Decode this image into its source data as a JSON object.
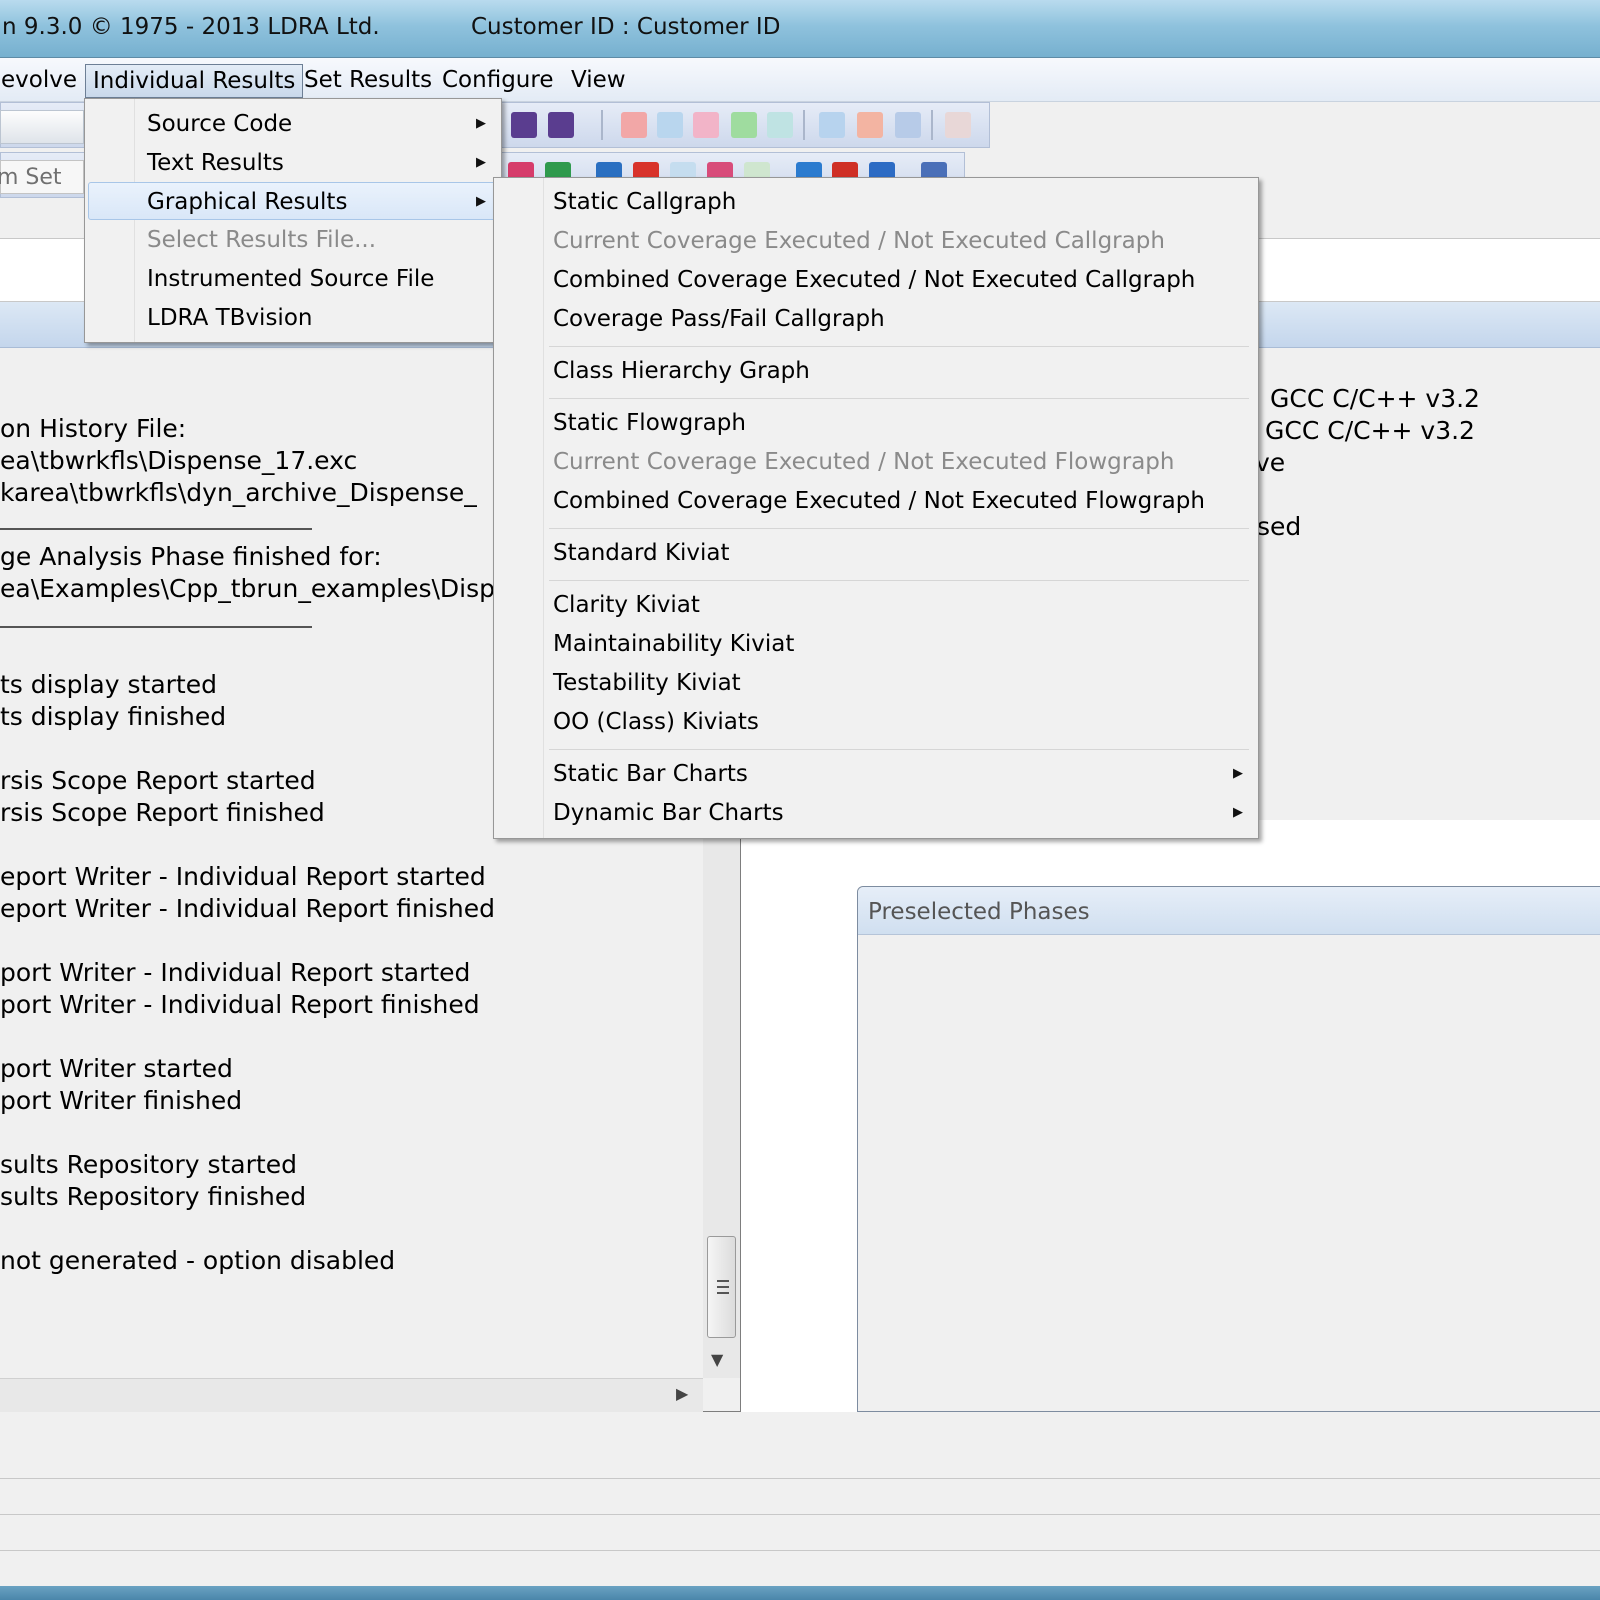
{
  "window": {
    "title": "n 9.3.0 © 1975 - 2013 LDRA Ltd.",
    "customer": "Customer ID : Customer ID"
  },
  "menubar": {
    "items": [
      "evolve",
      "Individual Results",
      "Set Results",
      "Configure",
      "View"
    ]
  },
  "toolbar": {
    "left_label": "m Set"
  },
  "individual_results_menu": {
    "items": [
      {
        "label": "Source Code",
        "submenu": true,
        "enabled": true
      },
      {
        "label": "Text Results",
        "submenu": true,
        "enabled": true
      },
      {
        "label": "Graphical Results",
        "submenu": true,
        "enabled": true,
        "highlighted": true
      },
      {
        "label": "Select Results File...",
        "submenu": false,
        "enabled": false
      },
      {
        "label": "Instrumented Source File",
        "submenu": false,
        "enabled": true
      },
      {
        "label": "LDRA TBvision",
        "submenu": false,
        "enabled": true
      }
    ]
  },
  "graphical_results_menu": {
    "items": [
      {
        "label": "Static Callgraph",
        "enabled": true
      },
      {
        "label": "Current Coverage Executed / Not Executed Callgraph",
        "enabled": false
      },
      {
        "label": "Combined Coverage Executed / Not Executed Callgraph",
        "enabled": true
      },
      {
        "label": "Coverage Pass/Fail Callgraph",
        "enabled": true
      },
      {
        "label": "Class Hierarchy Graph",
        "enabled": true
      },
      {
        "label": "Static Flowgraph",
        "enabled": true
      },
      {
        "label": "Current Coverage Executed / Not Executed Flowgraph",
        "enabled": false
      },
      {
        "label": "Combined Coverage Executed / Not Executed Flowgraph",
        "enabled": true
      },
      {
        "label": "Standard Kiviat",
        "enabled": true
      },
      {
        "label": "Clarity Kiviat",
        "enabled": true
      },
      {
        "label": "Maintainability Kiviat",
        "enabled": true
      },
      {
        "label": "Testability Kiviat",
        "enabled": true
      },
      {
        "label": "OO (Class) Kiviats",
        "enabled": true
      },
      {
        "label": "Static Bar Charts",
        "enabled": true,
        "submenu": true
      },
      {
        "label": "Dynamic Bar Charts",
        "enabled": true,
        "submenu": true
      }
    ]
  },
  "log": {
    "lines": [
      "on History File:",
      "ea\\tbwrkfls\\Dispense_17.exc",
      "karea\\tbwrkfls\\dyn_archive_Dispense_",
      "ge Analysis Phase finished for:",
      "ea\\Examples\\Cpp_tbrun_examples\\Disp",
      "ts display started",
      "ts display finished",
      "rsis Scope Report started",
      "rsis Scope Report finished",
      "eport Writer - Individual Report started",
      "eport Writer - Individual Report finished",
      "port Writer - Individual Report started",
      "port Writer - Individual Report finished",
      "port Writer started",
      "port Writer finished",
      "sults Repository started",
      "sults Repository finished",
      "not generated - option disabled"
    ]
  },
  "right_info": {
    "lines": [
      "GCC C/C++ v3.2",
      "GCC C/C++ v3.2",
      "ve",
      "sed"
    ]
  },
  "preselected": {
    "title": "Preselected Phases"
  },
  "colors": {
    "titlebar": "#8fc2dd",
    "menu_bg": "#f1f1f1",
    "disabled_text": "#8a8a8a",
    "highlight": "#d9e7f8"
  }
}
